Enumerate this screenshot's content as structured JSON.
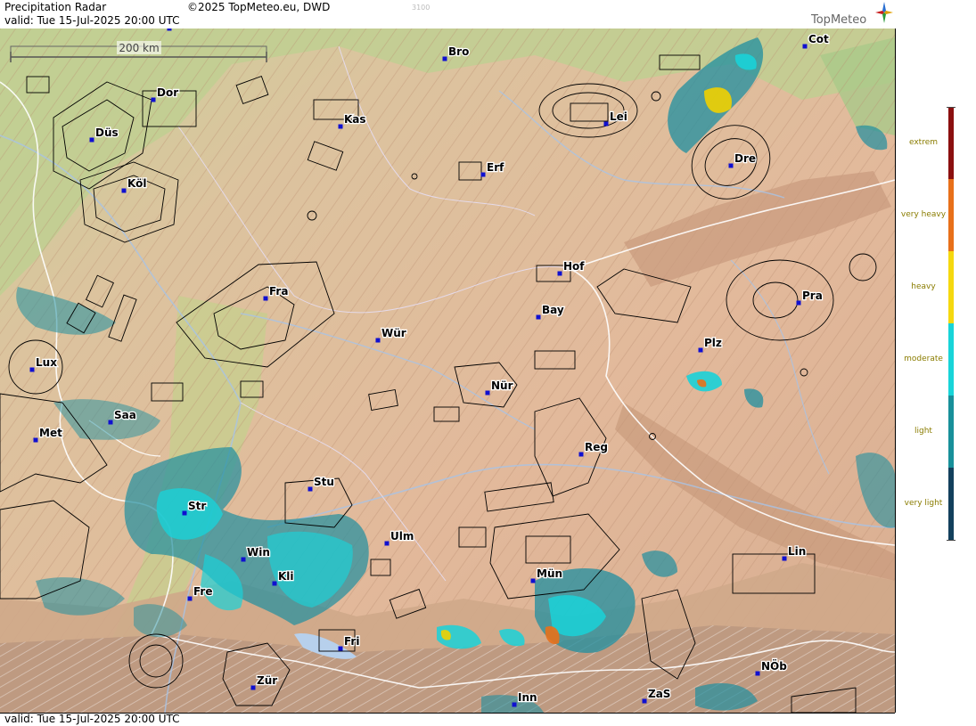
{
  "header": {
    "title": "Precipitation Radar",
    "copyright": "©2025 TopMeteo.eu, DWD",
    "code": "3100",
    "valid_line": "valid:  Tue  15-Jul-2025 20:00 UTC",
    "logo_text": "TopMeteo"
  },
  "footer": {
    "valid_line": "valid:  Tue  15-Jul-2025 20:00 UTC"
  },
  "scale_bar": {
    "label": "200 km"
  },
  "legend": {
    "categories": [
      {
        "label": "extrem",
        "color": "#8b0f0f"
      },
      {
        "label": "very heavy",
        "color": "#e8701a"
      },
      {
        "label": "heavy",
        "color": "#f5d80f"
      },
      {
        "label": "moderate",
        "color": "#18d4d8"
      },
      {
        "label": "light",
        "color": "#18909a"
      },
      {
        "label": "very light",
        "color": "#13405c"
      }
    ]
  },
  "cities": [
    {
      "id": "mun-north",
      "label": "Mün"
    },
    {
      "id": "bro",
      "label": "Bro"
    },
    {
      "id": "cot",
      "label": "Cot"
    },
    {
      "id": "dor",
      "label": "Dor"
    },
    {
      "id": "kas",
      "label": "Kas"
    },
    {
      "id": "lei",
      "label": "Lei"
    },
    {
      "id": "dus",
      "label": "Düs"
    },
    {
      "id": "erf",
      "label": "Erf"
    },
    {
      "id": "dre",
      "label": "Dre"
    },
    {
      "id": "kol",
      "label": "Köl"
    },
    {
      "id": "hof",
      "label": "Hof"
    },
    {
      "id": "fra",
      "label": "Fra"
    },
    {
      "id": "pra",
      "label": "Pra"
    },
    {
      "id": "bay",
      "label": "Bay"
    },
    {
      "id": "wur",
      "label": "Wür"
    },
    {
      "id": "plz",
      "label": "Plz"
    },
    {
      "id": "lux",
      "label": "Lux"
    },
    {
      "id": "nur",
      "label": "Nür"
    },
    {
      "id": "saa",
      "label": "Saa"
    },
    {
      "id": "met",
      "label": "Met"
    },
    {
      "id": "reg",
      "label": "Reg"
    },
    {
      "id": "stu",
      "label": "Stu"
    },
    {
      "id": "str",
      "label": "Str"
    },
    {
      "id": "ulm",
      "label": "Ulm"
    },
    {
      "id": "win",
      "label": "Win"
    },
    {
      "id": "mun",
      "label": "Mün"
    },
    {
      "id": "lin",
      "label": "Lin"
    },
    {
      "id": "kli",
      "label": "Kli"
    },
    {
      "id": "fre",
      "label": "Fre"
    },
    {
      "id": "fri",
      "label": "Fri"
    },
    {
      "id": "nob",
      "label": "NÖb"
    },
    {
      "id": "zur",
      "label": "Zür"
    },
    {
      "id": "zas",
      "label": "ZaS"
    },
    {
      "id": "inn",
      "label": "Inn"
    }
  ]
}
